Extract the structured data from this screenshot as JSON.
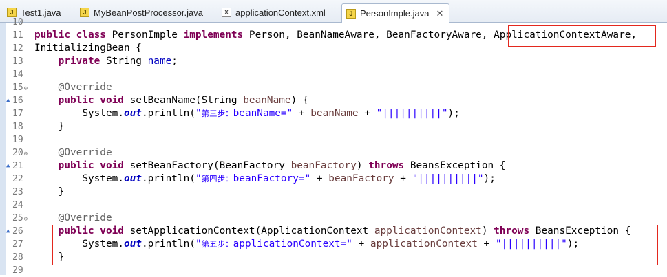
{
  "tabs": [
    {
      "label": "Test1.java",
      "icon": "java-file-icon",
      "icon_glyph": "J"
    },
    {
      "label": "MyBeanPostProcessor.java",
      "icon": "java-file-icon",
      "icon_glyph": "J"
    },
    {
      "label": "applicationContext.xml",
      "icon": "xml-file-icon",
      "icon_glyph": "X"
    },
    {
      "label": "PersonImple.java",
      "icon": "java-file-icon",
      "icon_glyph": "J",
      "active": true,
      "close": "✕"
    }
  ],
  "line_numbers": [
    "10",
    "11",
    "12",
    "13",
    "14",
    "15",
    "16",
    "17",
    "18",
    "19",
    "20",
    "21",
    "22",
    "23",
    "24",
    "25",
    "26",
    "27",
    "28",
    "29"
  ],
  "code": {
    "l11": {
      "kw1": "public class",
      "t1": " PersonImple ",
      "kw2": "implements",
      "t2": " Person, BeanNameAware, BeanFactoryAware, ",
      "t3": "ApplicationContextAware",
      "t4": ","
    },
    "l12": {
      "t1": "InitializingBean {"
    },
    "l13": {
      "kw1": "private",
      "t1": " String ",
      "f1": "name",
      "t2": ";"
    },
    "l15": {
      "a1": "@Override"
    },
    "l16": {
      "kw1": "public void",
      "t1": " setBeanName(String ",
      "p1": "beanName",
      "t2": ") {"
    },
    "l17": {
      "t1": "System.",
      "sf": "out",
      "t2": ".println(",
      "s1": "\"",
      "cjk": "第三步：",
      "s2": "beanName=\"",
      "t3": " + ",
      "p1": "beanName",
      "t4": " + ",
      "s3": "\"||||||||||\"",
      "t5": ");"
    },
    "l18": {
      "t1": "}"
    },
    "l20": {
      "a1": "@Override"
    },
    "l21": {
      "kw1": "public void",
      "t1": " setBeanFactory(BeanFactory ",
      "p1": "beanFactory",
      "t2": ") ",
      "kw2": "throws",
      "t3": " BeansException {"
    },
    "l22": {
      "t1": "System.",
      "sf": "out",
      "t2": ".println(",
      "s1": "\"",
      "cjk": "第四步：",
      "s2": "beanFactory=\"",
      "t3": " + ",
      "p1": "beanFactory",
      "t4": " + ",
      "s3": "\"||||||||||\"",
      "t5": ");"
    },
    "l23": {
      "t1": "}"
    },
    "l25": {
      "a1": "@Override"
    },
    "l26": {
      "kw1": "public void",
      "t1": " setApplicationContext(ApplicationContext ",
      "p1": "applicationContext",
      "t2": ") ",
      "kw2": "throws",
      "t3": " BeansException {"
    },
    "l27": {
      "t1": "System.",
      "sf": "out",
      "t2": ".println(",
      "s1": "\"",
      "cjk": "第五步：",
      "s2": "applicationContext=\"",
      "t3": " + ",
      "p1": "applicationContext",
      "t4": " + ",
      "s3": "\"||||||||||\"",
      "t5": ");"
    },
    "l28": {
      "t1": "}"
    }
  },
  "colors": {
    "keyword": "#7f0055",
    "string": "#2a00ff",
    "field": "#0000c0",
    "param": "#6a3e3e",
    "annotation": "#646464",
    "highlight_box": "#e3281e"
  }
}
